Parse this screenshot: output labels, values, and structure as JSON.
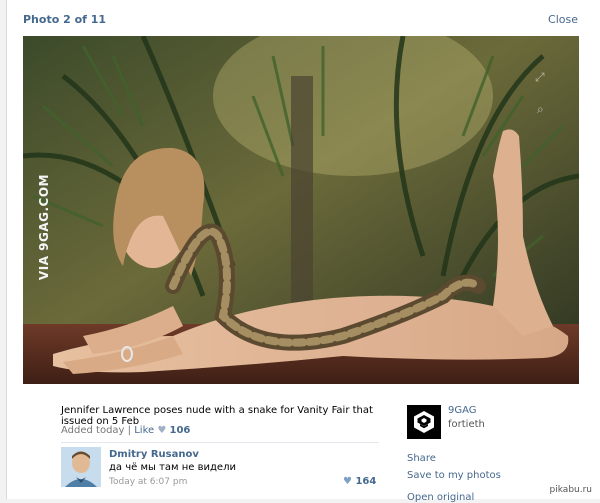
{
  "viewer": {
    "counter": "Photo 2 of 11",
    "close_label": "Close"
  },
  "photo": {
    "watermark": "VIA 9GAG.COM",
    "caption": "Jennifer Lawrence poses nude with a snake for Vanity Fair that issued on 5 Feb"
  },
  "meta": {
    "added": "Added today",
    "separator": "|",
    "like_label": "Like",
    "like_count": "106"
  },
  "comment": {
    "author": "Dmitry Rusanov",
    "text": "да чё мы там не видели",
    "time": "Today at 6:07 pm",
    "likes": "164"
  },
  "owner": {
    "name": "9GAG",
    "sub": "fortieth"
  },
  "actions": {
    "share": "Share",
    "save": "Save to my photos",
    "original": "Open original"
  },
  "site_watermark": "pikabu.ru",
  "colors": {
    "link": "#45688e",
    "muted": "#777777"
  },
  "icons": {
    "heart": "heart-icon",
    "zoom": "magnifier-icon",
    "expand": "expand-icon",
    "owner_logo": "9gag-logo"
  }
}
